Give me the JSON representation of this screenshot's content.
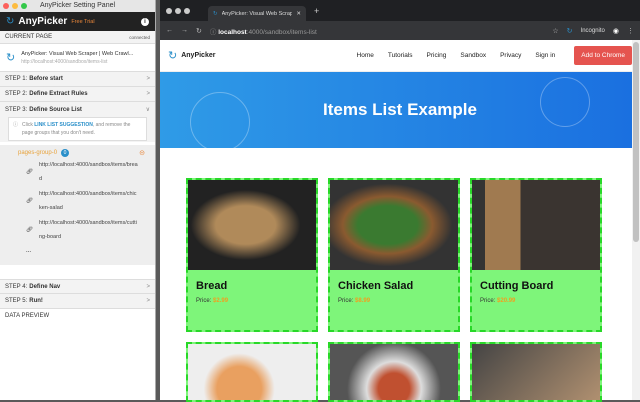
{
  "panel": {
    "window_title": "AnyPicker Setting Panel",
    "app_name": "AnyPicker",
    "trial": "Free Trial",
    "current_page_label": "CURRENT PAGE",
    "connection": "connected",
    "page_title": "AnyPicker: Visual Web Scraper | Web Crawl...",
    "page_url": "http://localhost:4000/sandbox/items-list",
    "steps": [
      {
        "n": "STEP 1:",
        "t": "Before start"
      },
      {
        "n": "STEP 2:",
        "t": "Define Extract Rules"
      },
      {
        "n": "STEP 3:",
        "t": "Define Source List"
      },
      {
        "n": "STEP 4:",
        "t": "Define Nav"
      },
      {
        "n": "STEP 5:",
        "t": "Run!"
      }
    ],
    "hint_pre": "Click",
    "hint_link": "LINK LIST SUGGESTION",
    "hint_post": ", and remove the page groups that you don't need.",
    "group_name": "pages-group-0",
    "group_count": "0",
    "links": [
      "http://localhost:4000/sandbox/items/bread",
      "http://localhost:4000/sandbox/items/chicken-salad",
      "http://localhost:4000/sandbox/items/cutting-board"
    ],
    "more": "...",
    "data_preview": "DATA PREVIEW"
  },
  "browser": {
    "tab_title": "AnyPicker: Visual Web Scrape",
    "url_host": "localhost",
    "url_path": ":4000/sandbox/items-list",
    "incognito": "Incognito"
  },
  "site": {
    "brand": "AnyPicker",
    "nav": [
      "Home",
      "Tutorials",
      "Pricing",
      "Sandbox",
      "Privacy",
      "Sign in"
    ],
    "cta": "Add to Chrome",
    "hero_title": "Items List Example",
    "price_label": "Price:",
    "items": [
      {
        "name": "Bread",
        "price": "$2.99"
      },
      {
        "name": "Chicken Salad",
        "price": "$8.99"
      },
      {
        "name": "Cutting Board",
        "price": "$20.99"
      }
    ]
  }
}
